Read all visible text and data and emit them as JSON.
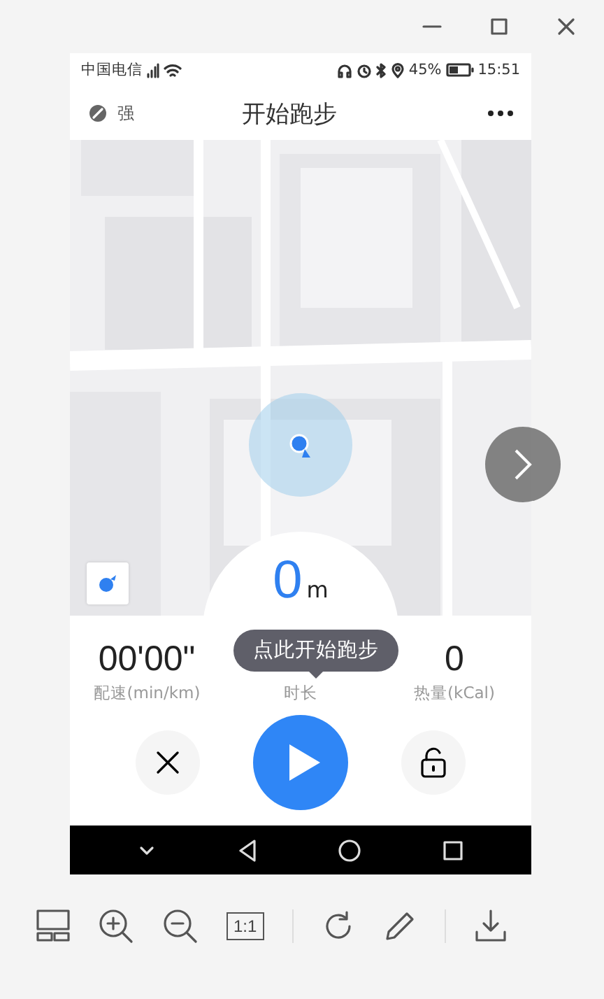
{
  "status_bar": {
    "carrier": "中国电信",
    "battery": "45%",
    "time": "15:51"
  },
  "header": {
    "signal_label": "强",
    "title": "开始跑步"
  },
  "map": {
    "kind": "picture",
    "distance": "0",
    "distance_unit": "m"
  },
  "stats": [
    {
      "value": "00'00\"",
      "label": "配速(min/km)"
    },
    {
      "label": "时长"
    },
    {
      "value": "0",
      "label": "热量(kCal)"
    }
  ],
  "tooltip": "点此开始跑步",
  "toolbar": {
    "ratio_label": "1:1"
  }
}
